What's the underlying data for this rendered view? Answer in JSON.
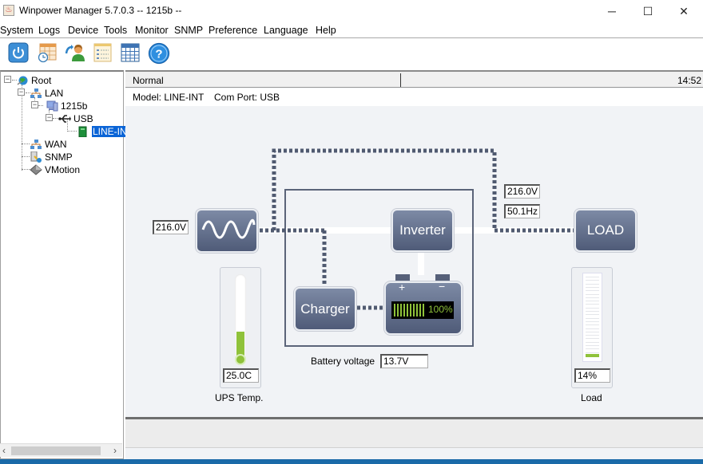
{
  "window": {
    "title": "Winpower Manager 5.7.0.3 -- 1215b --",
    "controls": {
      "minimize": "─",
      "maximize": "☐",
      "close": "✕"
    }
  },
  "menu": [
    "System",
    "Logs",
    "Device",
    "Tools",
    "Monitor",
    "SNMP",
    "Preference",
    "Language",
    "Help"
  ],
  "toolbar": [
    {
      "name": "power-icon"
    },
    {
      "name": "schedule-icon"
    },
    {
      "name": "user-agent-icon"
    },
    {
      "name": "event-list-icon"
    },
    {
      "name": "data-table-icon"
    },
    {
      "name": "help-icon"
    }
  ],
  "tree": {
    "root": "Root",
    "lan": "LAN",
    "host": "1215b",
    "usb": "USB",
    "device": "LINE-INT",
    "wan": "WAN",
    "snmp": "SNMP",
    "vmotion": "VMotion"
  },
  "status": {
    "text": "Normal",
    "time": "14:52"
  },
  "model": {
    "model_label": "Model: LINE-INT",
    "port_label": "Com Port: USB"
  },
  "diagram": {
    "input_voltage": "216.0V",
    "output_voltage": "216.0V",
    "output_frequency": "50.1Hz",
    "inverter_label": "Inverter",
    "charger_label": "Charger",
    "load_label": "LOAD",
    "battery_plus": "+",
    "battery_minus": "−",
    "battery_percent": "100%",
    "battery_level": 1.0,
    "battery_voltage_label": "Battery voltage",
    "battery_voltage": "13.7V",
    "ups_temp": "25.0C",
    "ups_temp_label": "UPS Temp.",
    "ups_temp_level": 0.3,
    "load_percent": "14%",
    "load_label_caption": "Load",
    "load_level": 0.14
  },
  "colors": {
    "device_button": "#5f6b88",
    "line_dash": "#505a70",
    "battery_green": "#8fc23a",
    "selection": "#0a64d6"
  }
}
